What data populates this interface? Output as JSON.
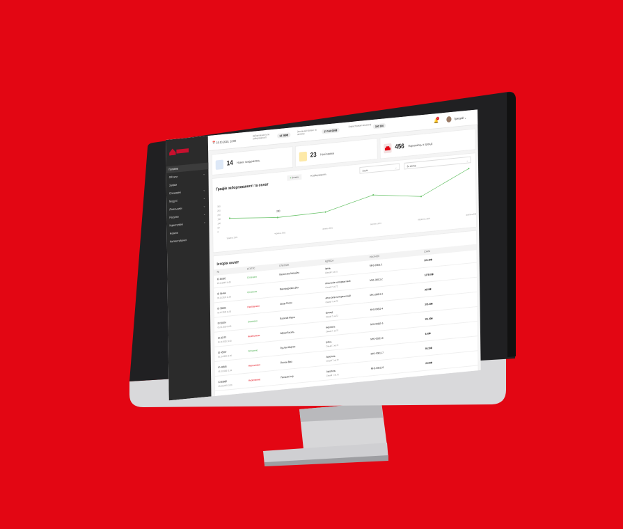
{
  "colors": {
    "background": "#e30613",
    "accent": "#c8102e",
    "sidebar": "#2b2b2b",
    "paid": "#4caf50",
    "unpaid": "#e30613",
    "chart_line": "#6ac36a"
  },
  "sidebar": {
    "items": [
      {
        "label": "Головна",
        "has_chevron": false,
        "active": true
      },
      {
        "label": "Об'єкти",
        "has_chevron": true
      },
      {
        "label": "Заявки",
        "has_chevron": false
      },
      {
        "label": "Споживачі",
        "has_chevron": true
      },
      {
        "label": "Модулі",
        "has_chevron": true
      },
      {
        "label": "Лічильники",
        "has_chevron": true
      },
      {
        "label": "Рахунки",
        "has_chevron": true
      },
      {
        "label": "Користувачі",
        "has_chevron": true
      },
      {
        "label": "Новини",
        "has_chevron": false
      },
      {
        "label": "Налаштування",
        "has_chevron": false
      }
    ]
  },
  "topbar": {
    "date": "19.10.2020, 12:00",
    "stat1_label": "Заборгованість по заборгованості",
    "stat1_value": "14 369₴",
    "stat2_label": "Загальний баланс по оплатах",
    "stat2_value": "13 144 000₴",
    "stat3_label": "Зареєстровані мешканці",
    "stat3_value": "160 100",
    "notifications": "3",
    "user_name": "Григорій"
  },
  "cards": [
    {
      "num": "14",
      "label": "Нових повідомлень",
      "icon": "message-icon"
    },
    {
      "num": "23",
      "label": "Нові заявки",
      "icon": "request-icon"
    },
    {
      "num": "456",
      "label": "Паркомісць в оренді",
      "icon": "car-icon"
    }
  ],
  "chart": {
    "title": "Графік заборгованості та оплат",
    "legend_paid": "Оплати",
    "legend_debt": "Заборгованість",
    "select_period": "За рік",
    "select_type": "За місяць",
    "annotation": "200"
  },
  "chart_data": {
    "type": "line",
    "categories": [
      "травень 2021",
      "червень 2021",
      "липень 2021",
      "серпень 2021",
      "вересень 2021",
      "жовтень 2021"
    ],
    "series": [
      {
        "name": "Оплати",
        "values": [
          160,
          110,
          120,
          280,
          200,
          500
        ]
      }
    ],
    "y_ticks": [
      "0",
      "50",
      "100",
      "150",
      "200",
      "250",
      "300"
    ],
    "ylim": [
      0,
      500
    ],
    "annotation_value": "200"
  },
  "table": {
    "title": "Історія оплат",
    "headers": [
      "№",
      "СТАТУС",
      "ПЛАТНИК",
      "АДРЕСА",
      "РАХУНОК",
      "СУМА"
    ],
    "rows": [
      {
        "id": "ID 36585",
        "date": "05.10.2020 11:00",
        "status": "Сплачено",
        "paid": true,
        "payer": "Васильєва Михайло",
        "addr": "Ірпінь",
        "addr2": "Сімьєй 7, кв.72",
        "account": "МН1-00811-1",
        "sum": "222.49₴"
      },
      {
        "id": "ID 54444",
        "date": "05.10.2020 11:00",
        "status": "Сплачено",
        "paid": true,
        "payer": "Винограднова Ціна",
        "addr": "Апостолів на Корвантиній",
        "addr2": "Сімьєй 7, кв.72",
        "account": "МН1-00811-2",
        "sum": "1279.00₴"
      },
      {
        "id": "ID 58835",
        "date": "05.10.2020 11:00",
        "status": "Неоплачено",
        "paid": false,
        "payer": "Захар Петро",
        "addr": "Апостолів на Корвантиній",
        "addr2": "Сімьєй 7, кв.72",
        "account": "МН1-00811-3",
        "sum": "30.50₴"
      },
      {
        "id": "ID 58874",
        "date": "05.10.2020 11:00",
        "status": "Сплачено",
        "paid": true,
        "payer": "Василий Марти",
        "addr": "Еспанд",
        "addr2": "Сімьєй 7, кв.72",
        "account": "МН1-00811-4",
        "sum": "378.00₴"
      },
      {
        "id": "ID 25122",
        "date": "05.10.2020 11:00",
        "status": "Неоплачено",
        "paid": false,
        "payer": "Абрам Василь",
        "addr": "Акрополь",
        "addr2": "Сімьєй 7, кв.72",
        "account": "МН1-00811-5",
        "sum": "111.00₴"
      },
      {
        "id": "ID 45587",
        "date": "05.10.2020 11:00",
        "status": "Сплачено",
        "paid": true,
        "payer": "Буслан Мартин",
        "addr": "Ірпінь",
        "addr2": "Сімьєй 7, кв.72",
        "account": "МН1-00811-6",
        "sum": "6.00₴"
      },
      {
        "id": "ID 48585",
        "date": "05.10.2020 11:00",
        "status": "Неоплачено",
        "paid": false,
        "payer": "Веснак Віра",
        "addr": "Акрополь",
        "addr2": "Сімьєй 7, кв.72",
        "account": "МН1-00811-7",
        "sum": "86.33₴"
      },
      {
        "id": "ID 85886",
        "date": "05.10.2020 11:00",
        "status": "Неоплачено",
        "paid": false,
        "payer": "Панасюк Ігор",
        "addr": "Акрополь",
        "addr2": "Сімьєй 7, кв.72",
        "account": "МН1-00811-8",
        "sum": "22.00₴"
      }
    ]
  }
}
